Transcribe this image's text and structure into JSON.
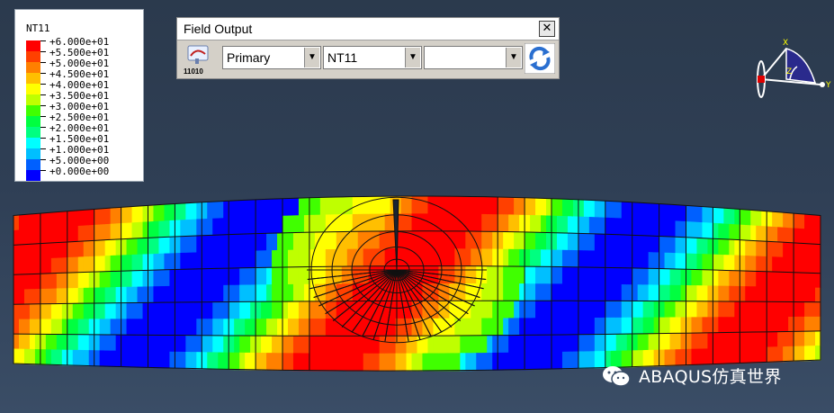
{
  "legend": {
    "title": "NT11",
    "labels": [
      "+6.000e+01",
      "+5.500e+01",
      "+5.000e+01",
      "+4.500e+01",
      "+4.000e+01",
      "+3.500e+01",
      "+3.000e+01",
      "+2.500e+01",
      "+2.000e+01",
      "+1.500e+01",
      "+1.000e+01",
      "+5.000e+00",
      "+0.000e+00"
    ],
    "colors": [
      "#ff0000",
      "#ff4000",
      "#ff8000",
      "#ffbf00",
      "#ffff00",
      "#bfff00",
      "#40ff00",
      "#00ff40",
      "#00ff80",
      "#00ffff",
      "#00bfff",
      "#0060ff",
      "#0000ff"
    ]
  },
  "field_output": {
    "title": "Field Output",
    "tool_label": "11010",
    "primary_select": "Primary",
    "variable_select": "NT11",
    "component_select": ""
  },
  "triad": {
    "x_label": "X",
    "y_label": "Y",
    "z_label": "Z"
  },
  "watermark": "ABAQUS仿真世界"
}
